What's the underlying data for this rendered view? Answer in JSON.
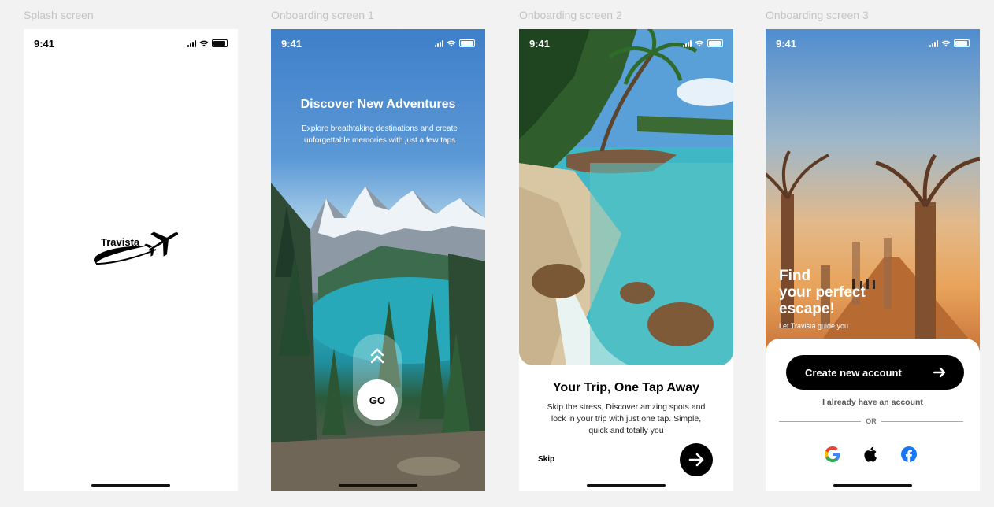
{
  "labels": {
    "splash": "Splash screen",
    "onb1": "Onboarding screen 1",
    "onb2": "Onboarding screen 2",
    "onb3": "Onboarding screen 3"
  },
  "status_time": "9:41",
  "splash": {
    "brand": "Travista"
  },
  "onb1": {
    "title": "Discover New Adventures",
    "subtitle": "Explore breathtaking destinations and create unforgettable memories with just a few taps",
    "go_label": "GO"
  },
  "onb2": {
    "title": "Your Trip, One Tap Away",
    "subtitle": "Skip the stress, Discover amzing spots and lock in your trip with just one tap. Simple, quick and totally you",
    "skip_label": "Skip"
  },
  "onb3": {
    "heading_line1": "Find",
    "heading_line2": "your perfect",
    "heading_line3": "escape!",
    "tagline": "Let Travista guide you",
    "create_label": "Create new account",
    "have_account_label": "I already have an account",
    "or_label": "OR",
    "social": [
      "google-icon",
      "apple-icon",
      "facebook-icon"
    ]
  },
  "colors": {
    "accent": "#000000",
    "sky": "#3f7fc9",
    "lake": "#2ea5b5",
    "facebook": "#1877f2"
  }
}
